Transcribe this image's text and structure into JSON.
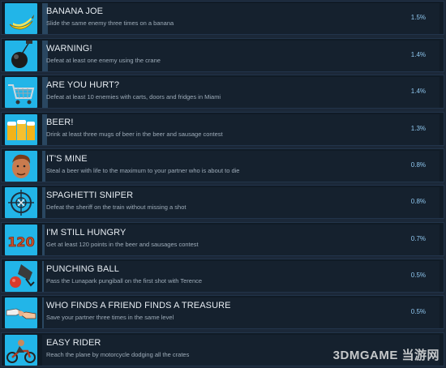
{
  "achievements": [
    {
      "title": "BANANA JOE",
      "description": "Slide the same enemy three times on a banana",
      "percent": "1.5%",
      "percent_value": 1.5,
      "icon": "banana-icon"
    },
    {
      "title": "WARNING!",
      "description": "Defeat at least one enemy using the crane",
      "percent": "1.4%",
      "percent_value": 1.4,
      "icon": "wrecking-ball-icon"
    },
    {
      "title": "ARE YOU HURT?",
      "description": "Defeat at least 10 enemies with carts, doors and fridges in Miami",
      "percent": "1.4%",
      "percent_value": 1.4,
      "icon": "shopping-cart-icon"
    },
    {
      "title": "BEER!",
      "description": "Drink at least three mugs of beer in the beer and sausage contest",
      "percent": "1.3%",
      "percent_value": 1.3,
      "icon": "beer-mugs-icon"
    },
    {
      "title": "IT'S MINE",
      "description": "Steal a beer with life to the maximum to your partner who is about to die",
      "percent": "0.8%",
      "percent_value": 0.8,
      "icon": "face-portrait-icon"
    },
    {
      "title": "SPAGHETTI SNIPER",
      "description": "Defeat the sheriff on the train without missing a shot",
      "percent": "0.8%",
      "percent_value": 0.8,
      "icon": "crosshair-icon"
    },
    {
      "title": "I'M STILL HUNGRY",
      "description": "Get at least 120 points in the beer and sausages contest",
      "percent": "0.7%",
      "percent_value": 0.7,
      "icon": "sausage-120-icon",
      "icon_text": "120"
    },
    {
      "title": "PUNCHING BALL",
      "description": "Pass the Lunapark pungiball on the first shot with Terence",
      "percent": "0.5%",
      "percent_value": 0.5,
      "icon": "punching-ball-icon"
    },
    {
      "title": "WHO FINDS A FRIEND FINDS A TREASURE",
      "description": "Save your partner three times in the same level",
      "percent": "0.5%",
      "percent_value": 0.5,
      "icon": "handshake-icon"
    },
    {
      "title": "EASY RIDER",
      "description": "Reach the plane by motorcycle dodging all the crates",
      "percent": "",
      "percent_value": null,
      "icon": "motorcycle-icon"
    }
  ],
  "watermark": "3DMGAME 当游网",
  "colors": {
    "icon_bg": "#22b5e8",
    "row_bg": "#101b26",
    "fill": "#2a4761",
    "percent_text": "#8ec6ee"
  }
}
